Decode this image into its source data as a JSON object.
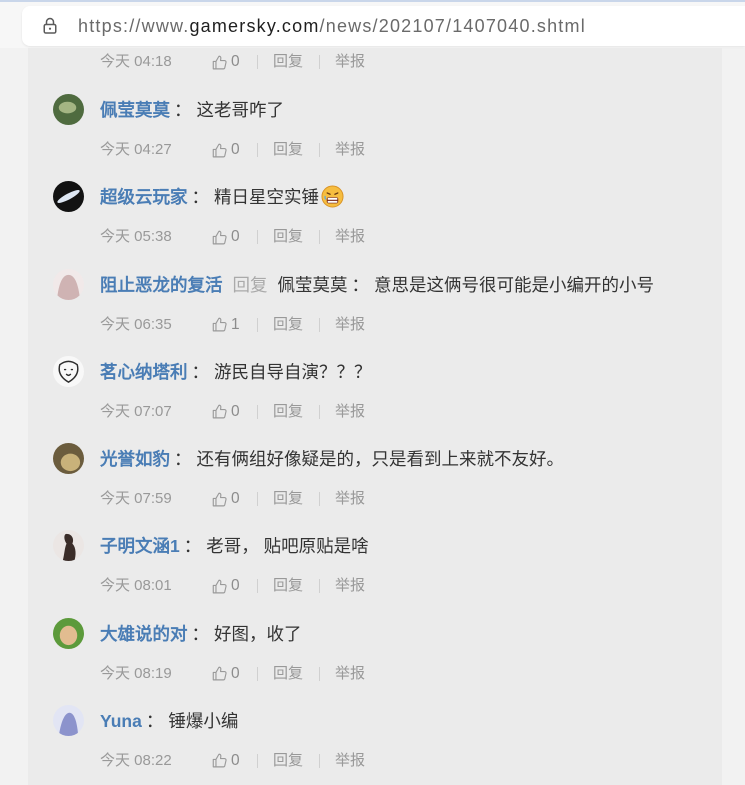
{
  "browser": {
    "url_prefix": "https://www.",
    "url_domain": "gamersky.com",
    "url_path": "/news/202107/1407040.shtml",
    "security_icon": "lock-icon"
  },
  "colors": {
    "username": "#4a7db5",
    "text": "#333333",
    "meta": "#999999",
    "reply-label": "#aaaaaa",
    "panel": "#ebebeb",
    "page": "#f2f2f2"
  },
  "colon": "：",
  "actions": {
    "like_icon": "thumbs-up-icon",
    "reply": "回复",
    "report": "举报"
  },
  "comments": [
    {
      "time": "今天 04:18",
      "likes": 0
    },
    {
      "user": "佩莹莫莫",
      "text": "这老哥咋了",
      "time": "今天 04:27",
      "likes": 0,
      "avatar": {
        "bg": "#4f6b3f",
        "fg": "#b3c28f"
      }
    },
    {
      "user": "超级云玩家",
      "text": "精日星空实锤",
      "emoji": "angry-face-emoji",
      "time": "今天 05:38",
      "likes": 0,
      "avatar": {
        "bg": "#121212",
        "fg": "#dde6f2"
      }
    },
    {
      "user": "阻止恶龙的复活",
      "reply_label": "回复",
      "reply_to": "佩莹莫莫",
      "text": "意思是这俩号很可能是小编开的小号",
      "time": "今天 06:35",
      "likes": 1,
      "avatar": {
        "bg": "#f1e9e9",
        "fg": "#cfb3b3"
      }
    },
    {
      "user": "茗心纳塔利",
      "text": "游民自导自演？？？",
      "time": "今天 07:07",
      "likes": 0,
      "avatar": {
        "bg": "#f8f8f8",
        "fg": "#2d2d2d"
      }
    },
    {
      "user": "光誉如豹",
      "text": "还有俩组好像疑是的，只是看到上来就不友好。",
      "time": "今天 07:59",
      "likes": 0,
      "avatar": {
        "bg": "#6b5c3d",
        "fg": "#c9b27a"
      }
    },
    {
      "user": "子明文涵1",
      "text": "老哥， 贴吧原贴是啥",
      "time": "今天 08:01",
      "likes": 0,
      "avatar": {
        "bg": "#ebe6e4",
        "fg": "#3a2c28"
      }
    },
    {
      "user": "大雄说的对",
      "text": "好图，收了",
      "time": "今天 08:19",
      "likes": 0,
      "avatar": {
        "bg": "#5c9a3b",
        "fg": "#e2bc90"
      }
    },
    {
      "user": "Yuna",
      "text": "锤爆小编",
      "time": "今天 08:22",
      "likes": 0,
      "avatar": {
        "bg": "#e2e5f4",
        "fg": "#8c93cc"
      }
    }
  ]
}
